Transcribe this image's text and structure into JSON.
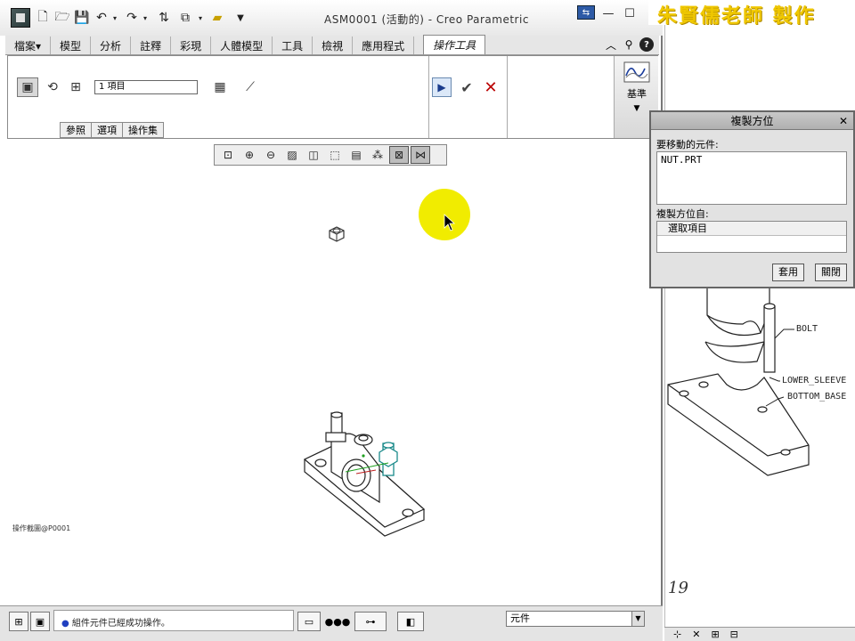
{
  "window": {
    "title": "ASM0001 (活動的) - Creo Parametric",
    "minimize": "—",
    "maximize": "☐"
  },
  "ribbon": {
    "tabs": [
      "檔案▾",
      "模型",
      "分析",
      "註釋",
      "彩現",
      "人體模型",
      "工具",
      "檢視",
      "應用程式"
    ],
    "active_tab": "操作工具",
    "items_field": "1 項目",
    "subtabs": [
      "參照",
      "選項",
      "操作集"
    ],
    "datum_label": "基準"
  },
  "graphics": {
    "model_label": "操作截圖@P0001"
  },
  "status": {
    "message": "組件元件已經成功操作。",
    "filter_value": "元件"
  },
  "watermark": "朱賢儒老師 製作",
  "dialog": {
    "title": "複製方位",
    "label_component": "要移動的元件:",
    "component_item": "NUT.PRT",
    "label_orient": "複製方位自:",
    "orient_item": "選取項目",
    "apply_button": "套用",
    "close_button": "關閉"
  },
  "reference": {
    "callout_bolt": "BOLT",
    "callout_sleeve": "LOWER_SLEEVE",
    "callout_base": "BOTTOM_BASE",
    "page_number": "19"
  },
  "colors": {
    "highlight": "#f1ec00",
    "watermark": "#f0c800"
  }
}
